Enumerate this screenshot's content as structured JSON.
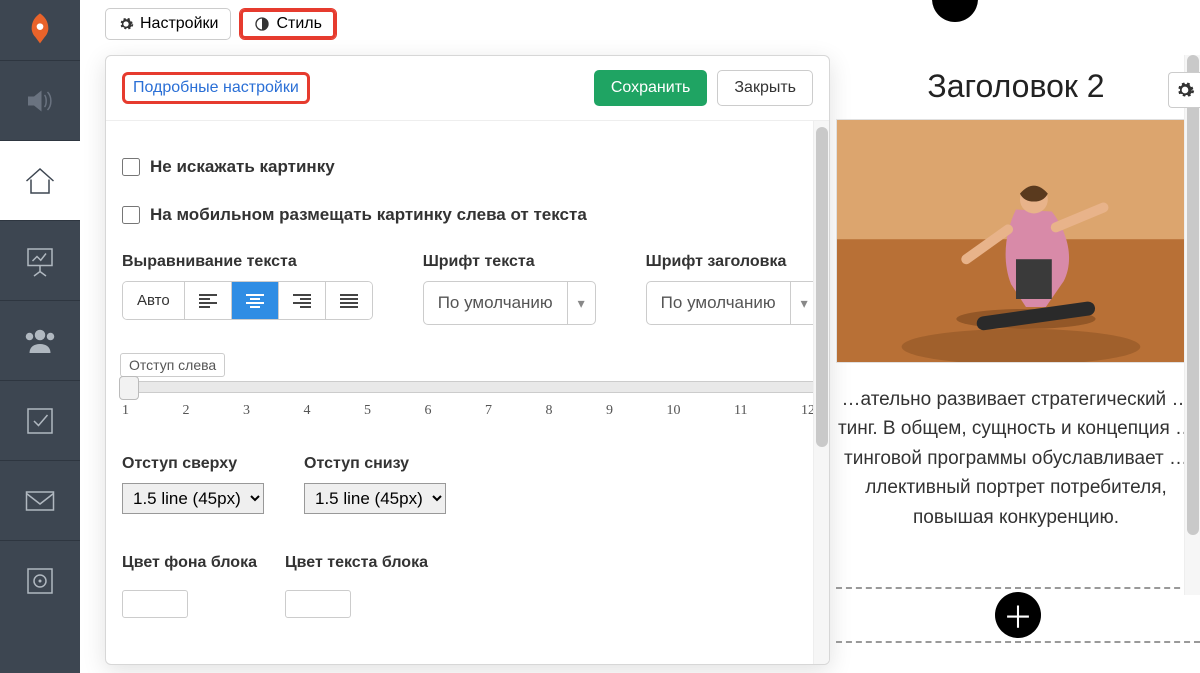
{
  "colors": {
    "accent": "#2f8de4",
    "success": "#1fa463",
    "danger": "#e63b2e",
    "sidebar": "#3d4651"
  },
  "topbar": {
    "settings_label": "Настройки",
    "style_label": "Стиль"
  },
  "popover": {
    "advanced_link": "Подробные настройки",
    "save_label": "Сохранить",
    "close_label": "Закрыть",
    "chk_no_distort": "Не искажать картинку",
    "chk_mobile_left": "На мобильном размещать картинку слева от текста",
    "align_label": "Выравнивание текста",
    "align_auto": "Авто",
    "font_text_label": "Шрифт текста",
    "font_heading_label": "Шрифт заголовка",
    "font_default": "По умолчанию",
    "slider_left_label": "Отступ слева",
    "ticks": [
      "1",
      "2",
      "3",
      "4",
      "5",
      "6",
      "7",
      "8",
      "9",
      "10",
      "11",
      "12"
    ],
    "margin_top_label": "Отступ сверху",
    "margin_bottom_label": "Отступ снизу",
    "margin_value": "1.5 line (45px)",
    "bg_color_label": "Цвет фона блока",
    "text_color_label": "Цвет текста блока"
  },
  "preview": {
    "heading": "Заголовок 2",
    "paragraph": "…ательно развивает стратегический …тинг. В общем, сущность и концепция …тинговой программы обуславливает …ллективный портрет потребителя, повышая конкуренцию."
  }
}
